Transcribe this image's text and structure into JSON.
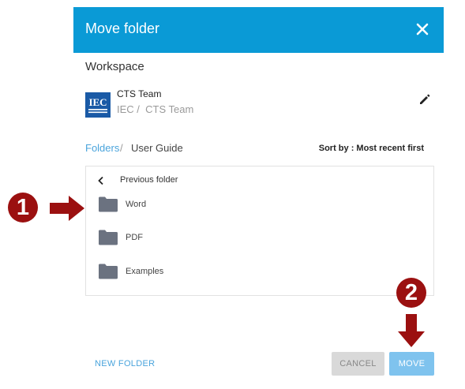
{
  "dialog": {
    "title": "Move folder",
    "close_icon": "close-icon",
    "colors": {
      "header": "#0a9ad6",
      "accent": "#4aa4dc",
      "callout": "#9b1010"
    }
  },
  "workspace": {
    "label": "Workspace",
    "logo_text": "IEC",
    "team_name": "CTS Team",
    "path": [
      "IEC",
      "CTS Team"
    ],
    "edit_icon": "pencil-icon"
  },
  "breadcrumb": {
    "root": "Folders",
    "separator": "/",
    "current": "User Guide"
  },
  "sort": {
    "label": "Sort by : Most recent first"
  },
  "folder_list": {
    "previous_label": "Previous folder",
    "folders": [
      {
        "name": "Word",
        "icon": "folder-icon"
      },
      {
        "name": "PDF",
        "icon": "folder-icon"
      },
      {
        "name": "Examples",
        "icon": "folder-icon"
      }
    ]
  },
  "footer": {
    "new_folder_label": "NEW FOLDER",
    "cancel_label": "CANCEL",
    "move_label": "MOVE"
  },
  "annotations": {
    "step1": "1",
    "step2": "2"
  }
}
